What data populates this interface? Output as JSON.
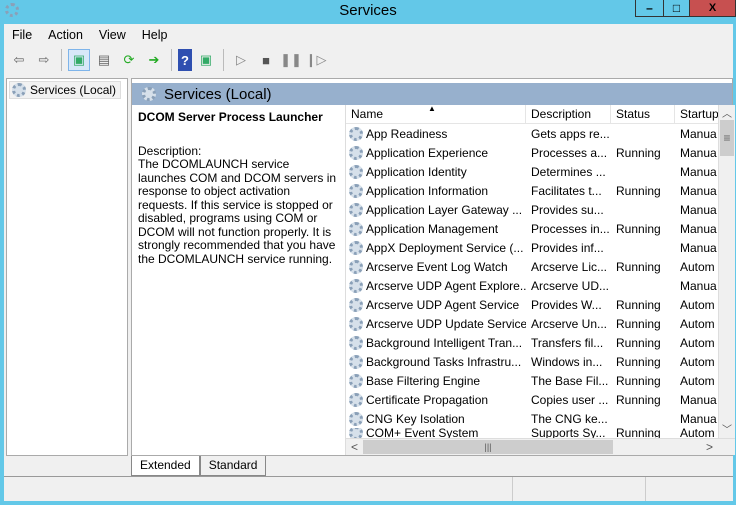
{
  "window": {
    "title": "Services",
    "min": "–",
    "max": "□",
    "close": "X",
    "accent": "#63c8e8",
    "close_color": "#c75050"
  },
  "menu": [
    "File",
    "Action",
    "View",
    "Help"
  ],
  "toolbar": [
    "back-icon",
    "forward-icon",
    "show-hide-tree-icon",
    "properties-icon",
    "refresh-icon",
    "export-list-icon",
    "help-icon",
    "action-pane-icon",
    "start-icon",
    "stop-icon",
    "pause-icon",
    "resume-icon"
  ],
  "tree": {
    "root": "Services (Local)"
  },
  "pane": {
    "title": "Services (Local)",
    "selected_service": "DCOM Server Process Launcher",
    "description_label": "Description:",
    "description": "The DCOMLAUNCH service launches COM and DCOM servers in response to object activation requests. If this service is stopped or disabled, programs using COM or DCOM will not function properly. It is strongly recommended that you have the DCOMLAUNCH service running."
  },
  "columns": [
    "Name",
    "Description",
    "Status",
    "Startup"
  ],
  "services": [
    {
      "name": "App Readiness",
      "desc": "Gets apps re...",
      "status": "",
      "startup": "Manua"
    },
    {
      "name": "Application Experience",
      "desc": "Processes a...",
      "status": "Running",
      "startup": "Manua"
    },
    {
      "name": "Application Identity",
      "desc": "Determines ...",
      "status": "",
      "startup": "Manua"
    },
    {
      "name": "Application Information",
      "desc": "Facilitates t...",
      "status": "Running",
      "startup": "Manua"
    },
    {
      "name": "Application Layer Gateway ...",
      "desc": "Provides su...",
      "status": "",
      "startup": "Manua"
    },
    {
      "name": "Application Management",
      "desc": "Processes in...",
      "status": "Running",
      "startup": "Manua"
    },
    {
      "name": "AppX Deployment Service (...",
      "desc": "Provides inf...",
      "status": "",
      "startup": "Manua"
    },
    {
      "name": "Arcserve Event Log Watch",
      "desc": "Arcserve Lic...",
      "status": "Running",
      "startup": "Autom"
    },
    {
      "name": "Arcserve UDP Agent Explore...",
      "desc": "Arcserve UD...",
      "status": "",
      "startup": "Manua"
    },
    {
      "name": "Arcserve UDP Agent Service",
      "desc": "Provides W...",
      "status": "Running",
      "startup": "Autom"
    },
    {
      "name": "Arcserve UDP Update Service",
      "desc": "Arcserve Un...",
      "status": "Running",
      "startup": "Autom"
    },
    {
      "name": "Background Intelligent Tran...",
      "desc": "Transfers fil...",
      "status": "Running",
      "startup": "Autom"
    },
    {
      "name": "Background Tasks Infrastru...",
      "desc": "Windows in...",
      "status": "Running",
      "startup": "Autom"
    },
    {
      "name": "Base Filtering Engine",
      "desc": "The Base Fil...",
      "status": "Running",
      "startup": "Autom"
    },
    {
      "name": "Certificate Propagation",
      "desc": "Copies user ...",
      "status": "Running",
      "startup": "Manua"
    },
    {
      "name": "CNG Key Isolation",
      "desc": "The CNG ke...",
      "status": "",
      "startup": "Manua"
    },
    {
      "name": "COM+ Event System",
      "desc": "Supports Sy...",
      "status": "Running",
      "startup": "Autom"
    }
  ],
  "tabs": [
    "Extended",
    "Standard"
  ]
}
